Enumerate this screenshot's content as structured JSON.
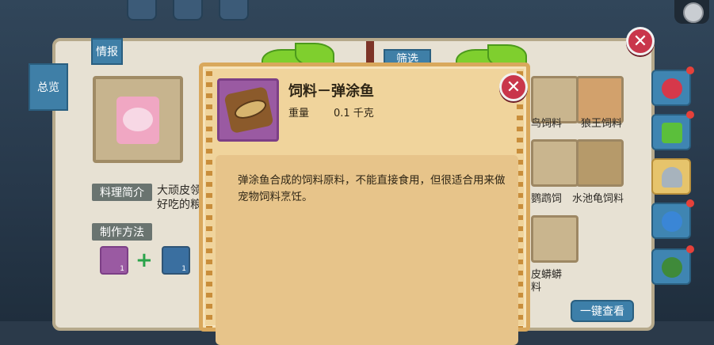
{
  "book": {
    "tab_overview": "总览",
    "tab_info": "情报",
    "tab_filter": "筛选",
    "cooking_intro_label": "料理简介",
    "cooking_intro_text_line1": "大顽皮领",
    "cooking_intro_text_line2": "好吃的粮",
    "recipe_label": "制作方法",
    "ingredient1_count": "1",
    "ingredient2_count": "1",
    "right_items": [
      {
        "label": "鸟饲料"
      },
      {
        "label": "狼王饲料"
      },
      {
        "label": "鹦鹉饲"
      },
      {
        "label": "水池龟饲料"
      },
      {
        "label": "皮蟒蟒"
      },
      {
        "label": "料"
      }
    ],
    "one_click_button": "一键查看"
  },
  "modal": {
    "title": "饲料－弹涂鱼",
    "weight_label": "重量",
    "weight_value": "0.1 千克",
    "description": "弹涂鱼合成的饲料原料，不能直接食用，但很适合用来做宠物饲料烹饪。",
    "close_symbol": "✕"
  },
  "book_close_symbol": "✕",
  "colors": {
    "modal_bg": "#f0d49c",
    "close_red": "#c9364b",
    "tab_blue": "#3f7fa7"
  }
}
